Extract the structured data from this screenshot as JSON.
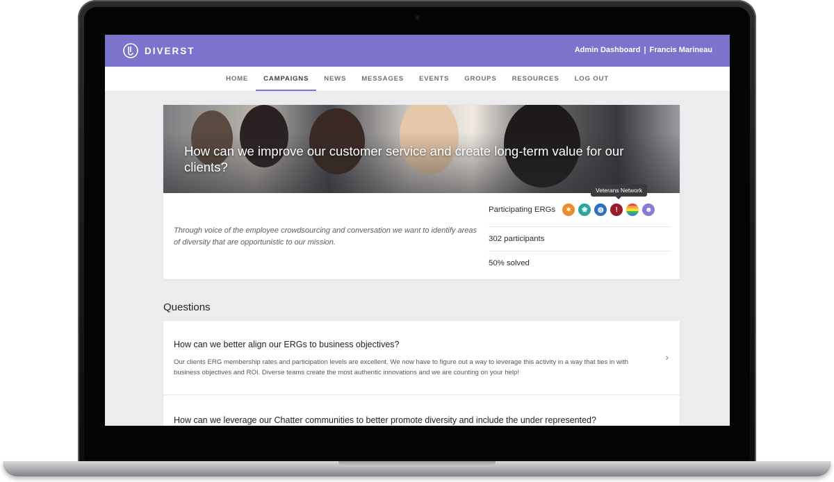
{
  "brand": {
    "name": "DIVERST",
    "accent": "#7b73cc"
  },
  "header": {
    "admin_link": "Admin Dashboard",
    "separator": "|",
    "user_name": "Francis Marineau"
  },
  "nav": {
    "items": [
      {
        "label": "HOME",
        "active": false
      },
      {
        "label": "CAMPAIGNS",
        "active": true
      },
      {
        "label": "NEWS",
        "active": false
      },
      {
        "label": "MESSAGES",
        "active": false
      },
      {
        "label": "EVENTS",
        "active": false
      },
      {
        "label": "GROUPS",
        "active": false
      },
      {
        "label": "RESOURCES",
        "active": false
      },
      {
        "label": "LOG OUT",
        "active": false
      }
    ]
  },
  "campaign": {
    "title": "How can we improve our customer service and create long-term value for our clients?",
    "description": "Through voice of the employee crowdsourcing and conversation we want to identify areas of diversity that are opportunistic to our mission.",
    "participating_label": "Participating ERGs",
    "erg_tooltip": "Veterans Network",
    "ergs": [
      {
        "icon": "sun-emblem-icon",
        "color": "#ef8a2c"
      },
      {
        "icon": "globe-leaf-icon",
        "color": "#2aa6a0"
      },
      {
        "icon": "striped-globe-icon",
        "color": "#2f6fc2"
      },
      {
        "icon": "exclamation-badge-icon",
        "color": "#9c1c2a"
      },
      {
        "icon": "rainbow-icon",
        "color": "#e9a83a"
      },
      {
        "icon": "profile-head-icon",
        "color": "#8a7bd6"
      }
    ],
    "participants": "302 participants",
    "solved": "50% solved"
  },
  "questions": {
    "heading": "Questions",
    "items": [
      {
        "title": "How can we better align our ERGs to business objectives?",
        "text": "Our clients ERG membership rates and participation levels are excellent. We now have to figure out a way to leverage this activity in a way that ties in with business objectives and ROI. Diverse teams create the most authentic innovations and we are counting on your help!"
      },
      {
        "title": "How can we leverage our Chatter communities to better promote diversity and include the under represented?"
      }
    ]
  }
}
